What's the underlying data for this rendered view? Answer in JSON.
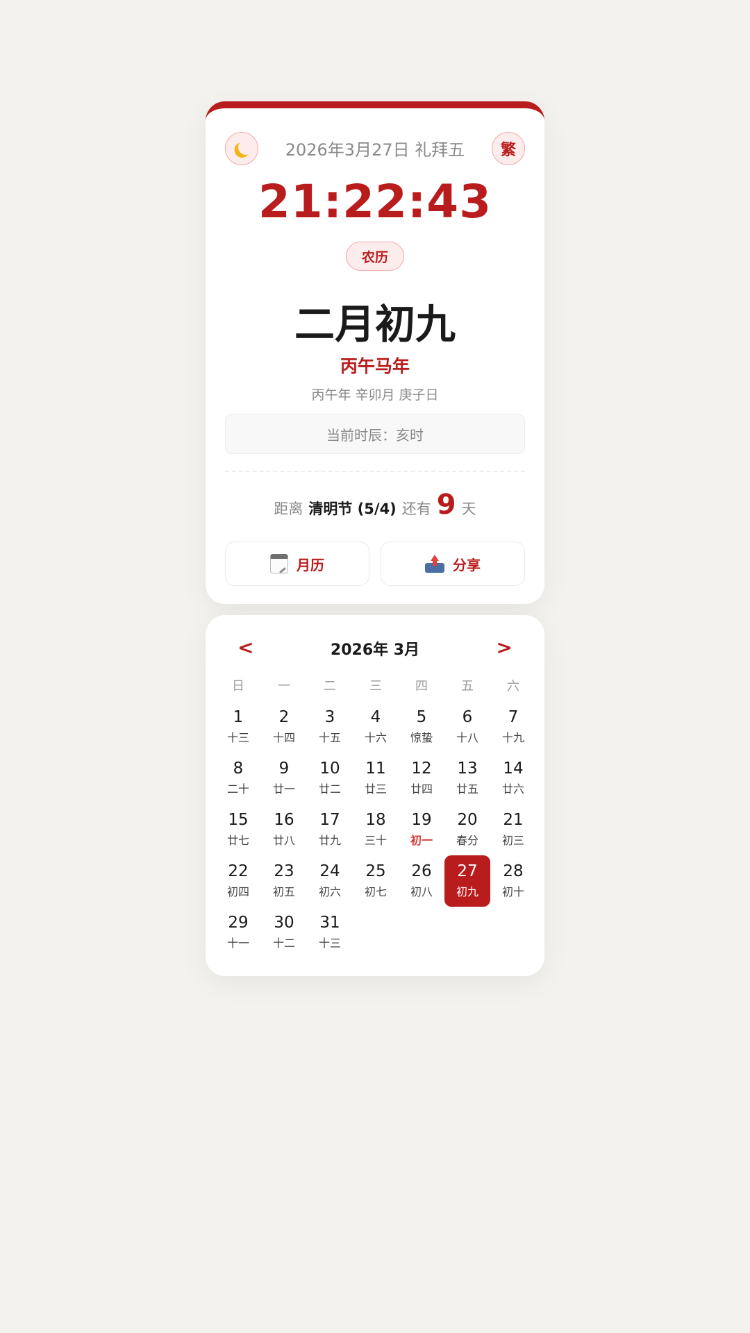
{
  "header": {
    "theme_toggle_icon": "moon-icon",
    "date_line": "2026年3月27日 礼拜五",
    "lang_toggle_label": "繁"
  },
  "clock": {
    "time": "21:22:43"
  },
  "lunar": {
    "tag_label": "农历",
    "date": "二月初九",
    "zodiac_year": "丙午马年",
    "ganzhi": "丙午年 辛卯月 庚子日",
    "shichen": "当前时辰：亥时"
  },
  "countdown": {
    "prefix": "距离",
    "festival": "清明节 (5/4)",
    "middle": "还有",
    "days": "9",
    "suffix": "天"
  },
  "actions": {
    "month_label": "月历",
    "month_icon": "calendar-icon",
    "share_label": "分享",
    "share_icon": "share-icon"
  },
  "calendar": {
    "prev": "<",
    "next": ">",
    "title": "2026年 3月",
    "weekdays": [
      "日",
      "一",
      "二",
      "三",
      "四",
      "五",
      "六"
    ],
    "days": [
      {
        "num": "1",
        "lunar": "十三"
      },
      {
        "num": "2",
        "lunar": "十四"
      },
      {
        "num": "3",
        "lunar": "十五"
      },
      {
        "num": "4",
        "lunar": "十六"
      },
      {
        "num": "5",
        "lunar": "惊蛰"
      },
      {
        "num": "6",
        "lunar": "十八"
      },
      {
        "num": "7",
        "lunar": "十九"
      },
      {
        "num": "8",
        "lunar": "二十"
      },
      {
        "num": "9",
        "lunar": "廿一"
      },
      {
        "num": "10",
        "lunar": "廿二"
      },
      {
        "num": "11",
        "lunar": "廿三"
      },
      {
        "num": "12",
        "lunar": "廿四"
      },
      {
        "num": "13",
        "lunar": "廿五"
      },
      {
        "num": "14",
        "lunar": "廿六"
      },
      {
        "num": "15",
        "lunar": "廿七"
      },
      {
        "num": "16",
        "lunar": "廿八"
      },
      {
        "num": "17",
        "lunar": "廿九"
      },
      {
        "num": "18",
        "lunar": "三十"
      },
      {
        "num": "19",
        "lunar": "初一",
        "holiday": true
      },
      {
        "num": "20",
        "lunar": "春分"
      },
      {
        "num": "21",
        "lunar": "初三"
      },
      {
        "num": "22",
        "lunar": "初四"
      },
      {
        "num": "23",
        "lunar": "初五"
      },
      {
        "num": "24",
        "lunar": "初六"
      },
      {
        "num": "25",
        "lunar": "初七"
      },
      {
        "num": "26",
        "lunar": "初八"
      },
      {
        "num": "27",
        "lunar": "初九",
        "today": true
      },
      {
        "num": "28",
        "lunar": "初十"
      },
      {
        "num": "29",
        "lunar": "十一"
      },
      {
        "num": "30",
        "lunar": "十二"
      },
      {
        "num": "31",
        "lunar": "十三"
      }
    ],
    "accent_color": "#b91c1c",
    "holiday_color": "#d63a3a"
  }
}
